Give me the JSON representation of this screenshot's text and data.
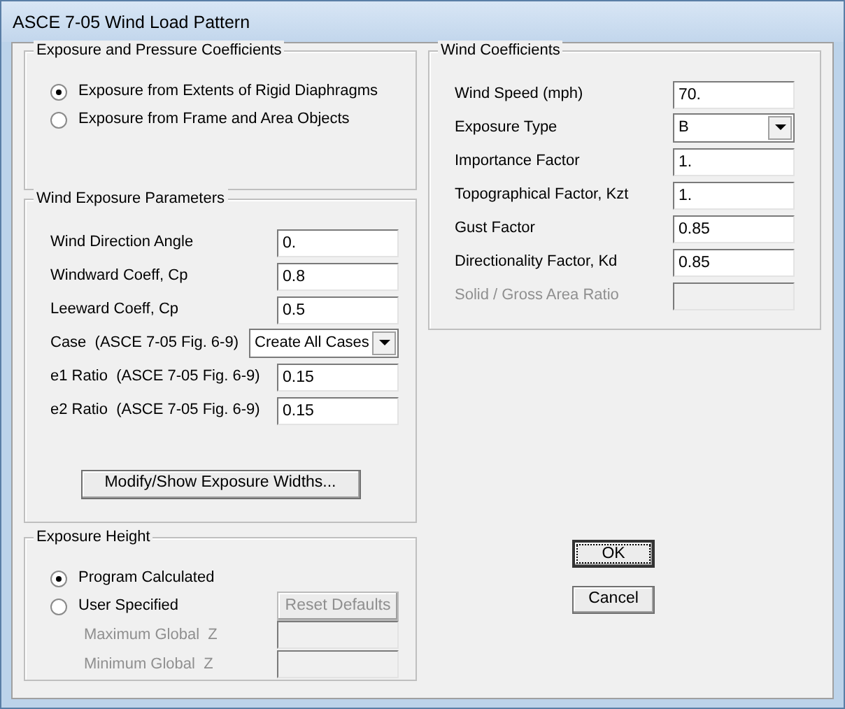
{
  "window": {
    "title": "ASCE 7-05 Wind Load Pattern"
  },
  "exposure_pressure": {
    "title": "Exposure and Pressure Coefficients",
    "options": [
      {
        "label": "Exposure from Extents of Rigid Diaphragms",
        "selected": true
      },
      {
        "label": "Exposure from Frame and Area Objects",
        "selected": false
      }
    ]
  },
  "wind_exposure": {
    "title": "Wind Exposure Parameters",
    "fields": [
      {
        "kind": "text",
        "label": "Wind Direction Angle",
        "value": "0."
      },
      {
        "kind": "text",
        "label": "Windward Coeff, Cp",
        "value": "0.8"
      },
      {
        "kind": "text",
        "label": "Leeward Coeff, Cp",
        "value": "0.5"
      },
      {
        "kind": "dropdown",
        "label": "Case  (ASCE 7-05 Fig. 6-9)",
        "value": "Create All Cases"
      },
      {
        "kind": "text",
        "label": "e1 Ratio  (ASCE 7-05 Fig. 6-9)",
        "value": "0.15"
      },
      {
        "kind": "text",
        "label": "e2 Ratio  (ASCE 7-05 Fig. 6-9)",
        "value": "0.15"
      }
    ],
    "button": "Modify/Show Exposure Widths..."
  },
  "exposure_height": {
    "title": "Exposure Height",
    "options": [
      {
        "label": "Program Calculated",
        "selected": true
      },
      {
        "label": "User Specified",
        "selected": false
      }
    ],
    "reset_button": {
      "label": "Reset Defaults",
      "disabled": true
    },
    "fields": [
      {
        "label": "Maximum Global  Z",
        "disabled": true
      },
      {
        "label": "Minimum Global  Z",
        "disabled": true
      }
    ]
  },
  "wind_coefficients": {
    "title": "Wind Coefficients",
    "fields": [
      {
        "kind": "text",
        "label": "Wind Speed (mph)",
        "value": "70.",
        "disabled": false
      },
      {
        "kind": "dropdown",
        "label": "Exposure Type",
        "value": "B",
        "disabled": false
      },
      {
        "kind": "text",
        "label": "Importance Factor",
        "value": "1.",
        "disabled": false
      },
      {
        "kind": "text",
        "label": "Topographical Factor, Kzt",
        "value": "1.",
        "disabled": false
      },
      {
        "kind": "text",
        "label": "Gust Factor",
        "value": "0.85",
        "disabled": false
      },
      {
        "kind": "text",
        "label": "Directionality Factor, Kd",
        "value": "0.85",
        "disabled": false
      },
      {
        "kind": "text",
        "label": "Solid / Gross Area Ratio",
        "disabled": true
      }
    ]
  },
  "buttons": [
    {
      "label": "OK",
      "focused": true
    },
    {
      "label": "Cancel",
      "focused": false
    }
  ]
}
